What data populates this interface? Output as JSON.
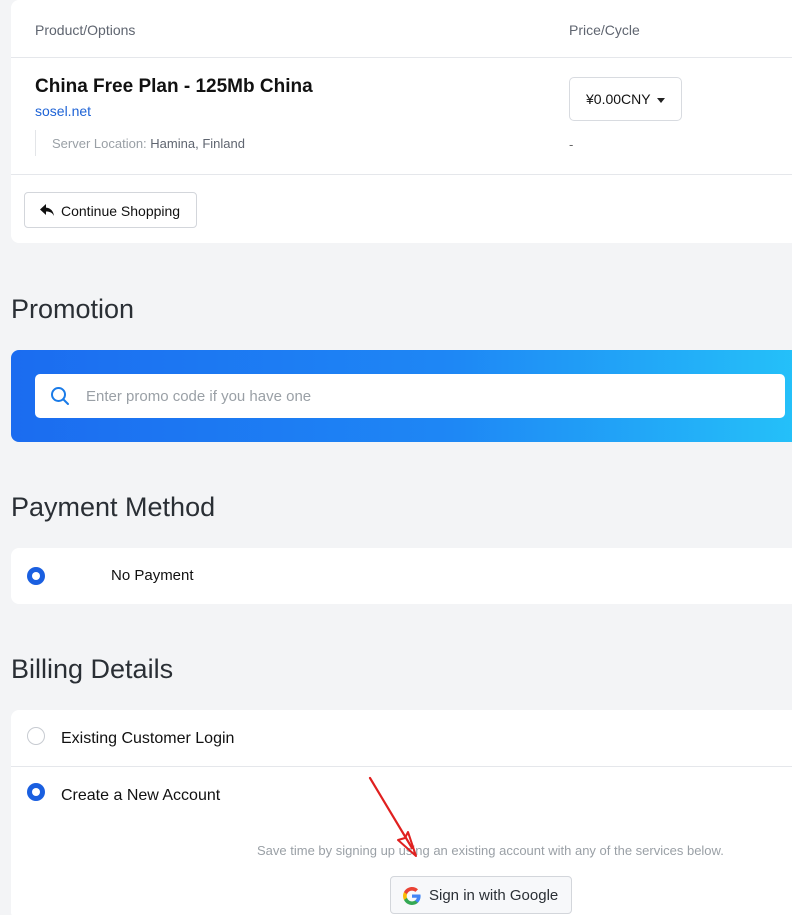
{
  "cart": {
    "col_product": "Product/Options",
    "col_price": "Price/Cycle",
    "product_name": "China Free Plan - 125Mb China",
    "product_domain": "sosel.net",
    "server_location_label": "Server Location:",
    "server_location_value": "Hamina, Finland",
    "price_value": "¥0.00CNY",
    "price_sub": "-",
    "continue_label": "Continue Shopping"
  },
  "promotion": {
    "title": "Promotion",
    "placeholder": "Enter promo code if you have one"
  },
  "payment": {
    "title": "Payment Method",
    "option": "No Payment"
  },
  "billing": {
    "title": "Billing Details",
    "existing_login": "Existing Customer Login",
    "new_account": "Create a New Account",
    "save_time_text": "Save time by signing up using an existing account with any of the services below.",
    "google_label": "Sign in with Google"
  },
  "colors": {
    "accent": "#1a5fe0",
    "link": "#1e63d6",
    "annotation_arrow": "#e0201f"
  },
  "icons": [
    "reply-icon",
    "search-icon",
    "google-icon",
    "chevron-down-icon"
  ]
}
